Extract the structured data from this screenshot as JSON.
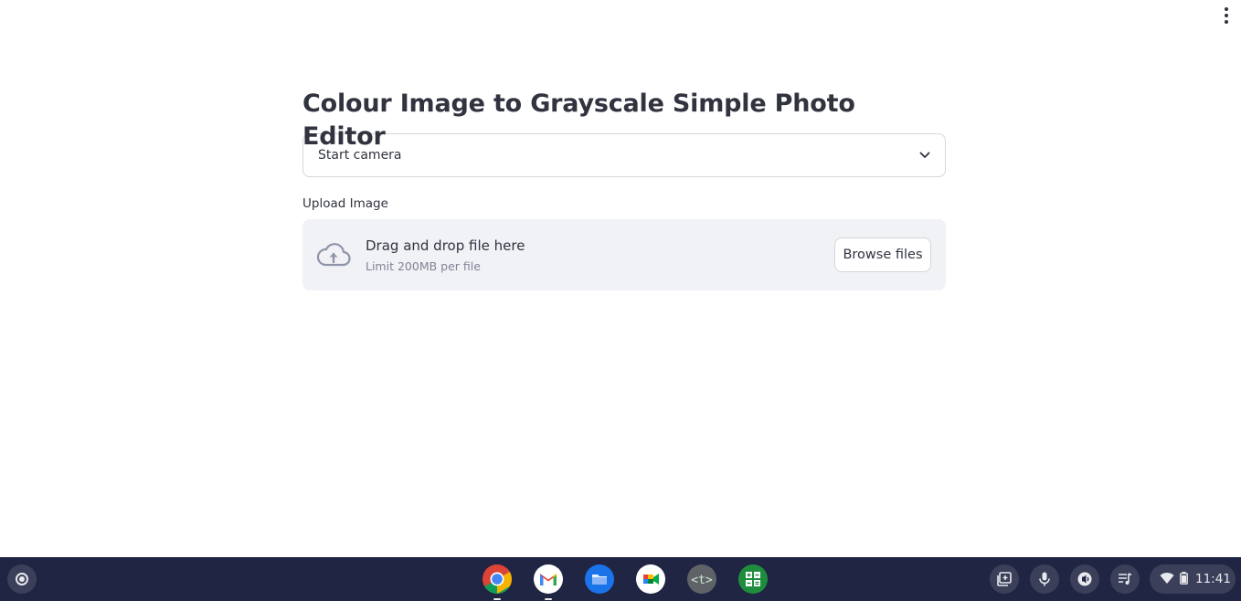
{
  "header": {
    "menu_icon": "kebab-menu-icon"
  },
  "main": {
    "title": "Colour Image to Grayscale Simple Photo Editor",
    "select": {
      "value": "Start camera",
      "icon": "chevron-down-icon"
    },
    "uploader": {
      "label": "Upload Image",
      "drop_title": "Drag and drop file here",
      "drop_subtitle": "Limit 200MB per file",
      "browse_label": "Browse files",
      "icon": "cloud-upload-icon"
    }
  },
  "shelf": {
    "launcher_icon": "launcher-icon",
    "apps": [
      {
        "name": "Chrome",
        "icon": "chrome-icon",
        "open": true
      },
      {
        "name": "Gmail",
        "icon": "gmail-icon",
        "open": true
      },
      {
        "name": "Files",
        "icon": "files-icon",
        "open": false
      },
      {
        "name": "Google Meet",
        "icon": "meet-icon",
        "open": false
      },
      {
        "name": "Text",
        "icon": "text-editor-icon",
        "open": false
      },
      {
        "name": "Calculator",
        "icon": "calculator-icon",
        "open": false
      }
    ],
    "tray": {
      "icons": [
        "screen-capture-icon",
        "microphone-icon",
        "accessibility-icon",
        "media-controls-icon"
      ],
      "status_icons": [
        "wifi-icon",
        "battery-icon"
      ],
      "time": "11:41"
    }
  },
  "colors": {
    "text": "#31333f",
    "muted": "#808495",
    "dropzone_bg": "#f0f2f6",
    "border": "#d6d6d9",
    "shelf_bg": "#202543"
  }
}
